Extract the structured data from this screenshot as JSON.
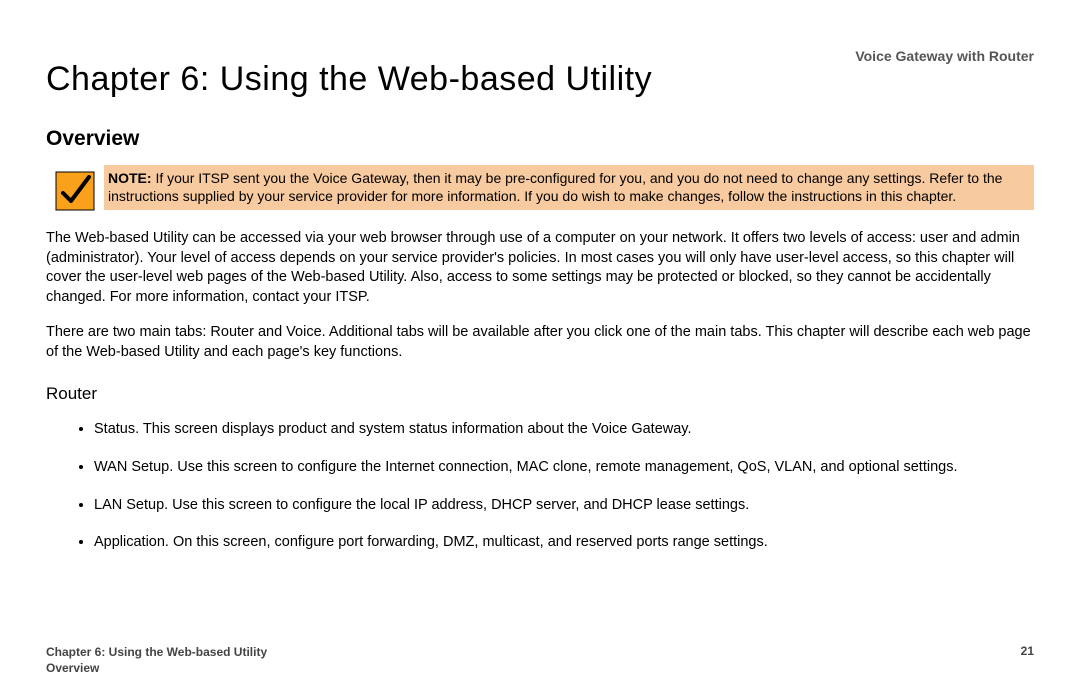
{
  "header": {
    "product": "Voice Gateway with Router"
  },
  "chapter": {
    "title": "Chapter 6: Using the Web-based Utility"
  },
  "section": {
    "heading": "Overview"
  },
  "note": {
    "label": "NOTE:",
    "body": "  If your ITSP sent you the Voice Gateway, then it may be pre-configured for you, and you do not need to change any settings. Refer to the instructions supplied by your service provider for more information. If you do wish to make changes, follow the instructions in this chapter."
  },
  "paragraphs": {
    "p1": "The Web-based Utility can be accessed via your web browser through use of a computer on your network. It offers two levels of access: user and admin (administrator). Your level of access depends on your service provider's policies. In most cases you will only have user-level access, so this chapter will cover the user-level web pages of the Web-based Utility. Also, access to some settings may be protected or blocked, so they cannot be accidentally changed. For more information, contact your ITSP.",
    "p2": "There are two main tabs: Router and Voice. Additional tabs will be available after you click one of the main tabs. This chapter will describe each web page of the Web-based Utility and each page's key functions."
  },
  "router": {
    "heading": "Router",
    "items": [
      "Status. This screen displays product and system status information about the Voice Gateway.",
      "WAN Setup. Use this screen to configure the Internet connection, MAC clone, remote management, QoS, VLAN, and optional settings.",
      "LAN Setup. Use this screen to configure the local IP address, DHCP server, and DHCP lease settings.",
      "Application. On this screen, configure port forwarding, DMZ, multicast, and reserved ports range settings."
    ]
  },
  "footer": {
    "chapter_line": "Chapter 6: Using the Web-based Utility",
    "section_line": "Overview",
    "page_number": "21"
  }
}
